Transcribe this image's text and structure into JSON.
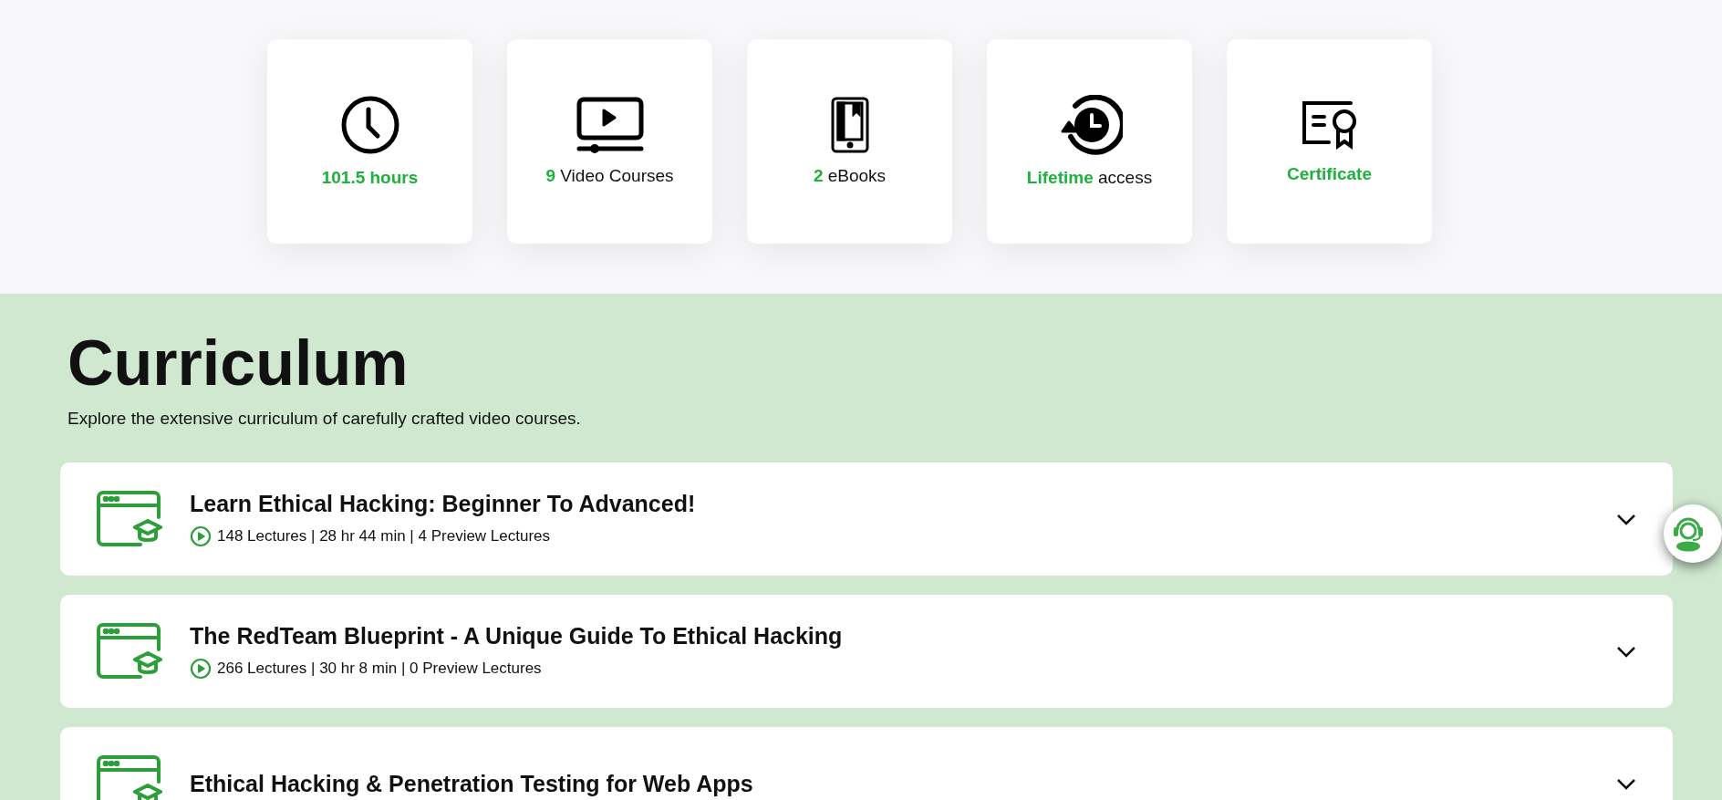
{
  "features": [
    {
      "text": "101.5 hours",
      "emphasized": true
    },
    {
      "text": "**9** Video Courses",
      "emphasized": false
    },
    {
      "text": "**2** eBooks",
      "emphasized": false
    },
    {
      "text": "**Lifetime** access",
      "emphasized": false
    },
    {
      "text": "Certificate",
      "emphasized": true
    }
  ],
  "curriculum": {
    "title": "Curriculum",
    "subtitle": "Explore the extensive curriculum of carefully crafted video courses.",
    "courses": [
      {
        "title": "Learn Ethical Hacking: Beginner To Advanced!",
        "meta": "148 Lectures | 28 hr 44 min | 4 Preview Lectures",
        "expanded": false
      },
      {
        "title": "The RedTeam Blueprint - A Unique Guide To Ethical Hacking",
        "meta": "266 Lectures | 30 hr 8 min | 0 Preview Lectures",
        "expanded": false
      },
      {
        "title": "Ethical Hacking & Penetration Testing for Web Apps",
        "expanded": false
      }
    ]
  }
}
